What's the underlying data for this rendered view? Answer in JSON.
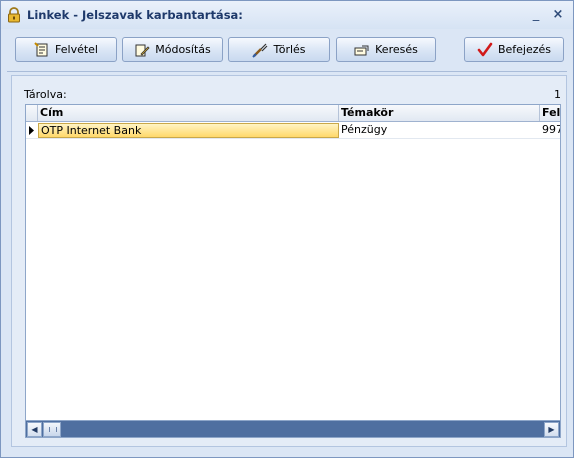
{
  "window": {
    "title": "Linkek - Jelszavak karbantartása:",
    "minimize_glyph": "_",
    "close_glyph": "×"
  },
  "toolbar": {
    "new_label": "Felvétel",
    "edit_label": "Módosítás",
    "delete_label": "Törlés",
    "search_label": "Keresés",
    "finish_label": "Befejezés"
  },
  "panel": {
    "stored_label": "Tárolva:",
    "stored_count": "1"
  },
  "grid": {
    "columns": [
      "Cím",
      "Témakör",
      "Fel"
    ],
    "rows": [
      {
        "title": "OTP Internet Bank",
        "topic": "Pénzügy",
        "extra": "997"
      }
    ]
  },
  "colors": {
    "accent": "#1f3a6b",
    "selection": "#ffd86a",
    "scrollbar": "#4f6fa0"
  },
  "icons": [
    "lock-icon",
    "new-record-icon",
    "edit-icon",
    "delete-icon",
    "search-icon",
    "checkmark-icon"
  ]
}
